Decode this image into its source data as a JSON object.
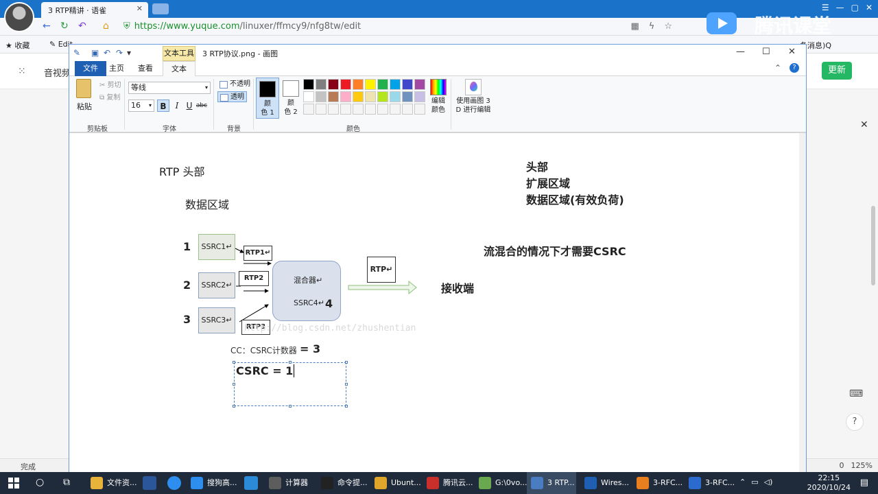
{
  "browser": {
    "tab_title": "3 RTP精讲 · 语雀",
    "tab_close": "✕",
    "url_scheme": "https://",
    "url_host": "www.yuque.com",
    "url_path": "/linuxer/ffmcy9/nfg8tw/edit",
    "bookmark_favorites": "收藏",
    "bookmark_edit": "Edit",
    "bookmark_right": "条消息)Q",
    "logo_text": "腾讯课堂"
  },
  "yuque": {
    "page_title": "音视频",
    "update_button": "更新",
    "status": "完成",
    "status_right_count": "0",
    "zoom": "125%"
  },
  "paint": {
    "window_title": "3 RTP协议.png - 画图",
    "text_tools_label": "文本工具",
    "tabs": [
      "文件",
      "主页",
      "查看",
      "文本"
    ],
    "clipboard": {
      "paste": "粘贴",
      "cut": "剪切",
      "copy": "复制",
      "group": "剪贴板"
    },
    "font": {
      "family": "等线",
      "size": "16",
      "bold": "B",
      "italic": "I",
      "underline": "U",
      "strike": "abc",
      "group": "字体"
    },
    "background": {
      "opaque": "不透明",
      "transparent": "透明",
      "group": "背景"
    },
    "colors": {
      "color1_line1": "颜",
      "color1_line2": "色 1",
      "color2_line1": "颜",
      "color2_line2": "色 2",
      "edit_colors_line1": "编辑",
      "edit_colors_line2": "颜色",
      "paint3d_line1": "使用画图 3",
      "paint3d_line2": "D 进行编辑",
      "group": "颜色",
      "color1": "#000000",
      "color2": "#ffffff",
      "palette": [
        "#000000",
        "#7f7f7f",
        "#880015",
        "#ed1c24",
        "#ff7f27",
        "#fff200",
        "#22b14c",
        "#00a2e8",
        "#3f48cc",
        "#a349a4",
        "#ffffff",
        "#c3c3c3",
        "#b97a57",
        "#ffaec9",
        "#ffc90e",
        "#efe4b0",
        "#b5e61d",
        "#99d9ea",
        "#7092be",
        "#c8bfe7",
        "#f4f4f4",
        "#f4f4f4",
        "#f4f4f4",
        "#f4f4f4",
        "#f4f4f4",
        "#f4f4f4",
        "#f4f4f4",
        "#f4f4f4",
        "#f4f4f4",
        "#f4f4f4"
      ]
    }
  },
  "canvas": {
    "rtp_header": "RTP 头部",
    "data_region": "数据区域",
    "right_list": [
      "头部",
      "扩展区域",
      "数据区域(有效负荷)"
    ],
    "mix_note": "流混合的情况下才需要CSRC",
    "receiver": "接收端",
    "numbers": [
      "1",
      "2",
      "3",
      "4"
    ],
    "ssrc_boxes": [
      "SSRC1↵",
      "SSRC2↵",
      "SSRC3↵"
    ],
    "rtp_boxes": [
      "RTP1↵",
      "RTP2",
      "RTP3"
    ],
    "mixer_label": "混合器↵",
    "mixer_ssrc": "SSRC4↵",
    "rtp_out": "RTP↵",
    "watermark": "http://blog.csdn.net/zhushentian",
    "cc_label": "CC：CSRC计数器",
    "cc_value": "= 3",
    "csrc_text": "CSRC = 1"
  },
  "taskbar": {
    "items": [
      "文件资...",
      "搜狗高...",
      "计算器",
      "命令提...",
      "Ubunt...",
      "腾讯云...",
      "G:\\0vo...",
      "3 RTP...",
      "Wires...",
      "3-RFC...",
      "3-RFC..."
    ],
    "time": "22:15",
    "date": "2020/10/24"
  }
}
